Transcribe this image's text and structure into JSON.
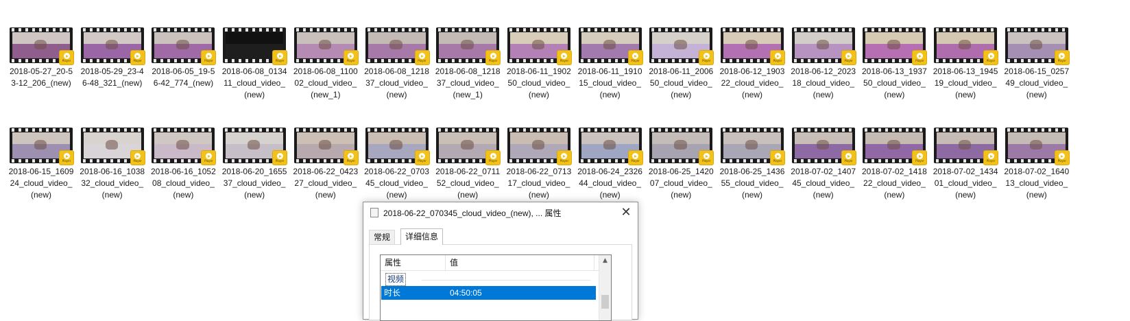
{
  "files": [
    {
      "name": "2018-05-27_20-53-12_206_(new)",
      "wall": "#cfc6c3",
      "bed": "#8f5e8d",
      "dark": false
    },
    {
      "name": "2018-05-29_23-46-48_321_(new)",
      "wall": "#d2c9c6",
      "bed": "#9a66a6",
      "dark": false
    },
    {
      "name": "2018-06-05_19-56-42_774_(new)",
      "wall": "#cbc1bd",
      "bed": "#a06aa7",
      "dark": false
    },
    {
      "name": "2018-06-08_013411_cloud_video_(new)",
      "wall": "#111111",
      "bed": "#1e1e1e",
      "dark": true
    },
    {
      "name": "2018-06-08_110002_cloud_video_(new_1)",
      "wall": "#c9c0bc",
      "bed": "#b58bb4",
      "dark": false
    },
    {
      "name": "2018-06-08_121837_cloud_video_(new)",
      "wall": "#c3bab6",
      "bed": "#a779a9",
      "dark": false
    },
    {
      "name": "2018-06-08_121837_cloud_video_(new_1)",
      "wall": "#c3bab6",
      "bed": "#a779a9",
      "dark": false
    },
    {
      "name": "2018-06-11_190250_cloud_video_(new)",
      "wall": "#d8cdb9",
      "bed": "#b481b6",
      "dark": false
    },
    {
      "name": "2018-06-11_191015_cloud_video_(new)",
      "wall": "#d5ccbd",
      "bed": "#a37aae",
      "dark": false
    },
    {
      "name": "2018-06-11_200650_cloud_video_(new)",
      "wall": "#d6d0cb",
      "bed": "#c4b3d6",
      "dark": false
    },
    {
      "name": "2018-06-12_190322_cloud_video_(new)",
      "wall": "#d8cbb8",
      "bed": "#b371b3",
      "dark": false
    },
    {
      "name": "2018-06-12_202318_cloud_video_(new)",
      "wall": "#d3cdc9",
      "bed": "#b793c2",
      "dark": false
    },
    {
      "name": "2018-06-13_193750_cloud_video_(new)",
      "wall": "#d6cab3",
      "bed": "#b66fb2",
      "dark": false
    },
    {
      "name": "2018-06-13_194519_cloud_video_(new)",
      "wall": "#d4c8b2",
      "bed": "#b06dae",
      "dark": false
    },
    {
      "name": "2018-06-15_025749_cloud_video_(new)",
      "wall": "#c9c2c0",
      "bed": "#a58fb3",
      "dark": false
    },
    {
      "name": "2018-06-15_160924_cloud_video_(new)",
      "wall": "#cdc4be",
      "bed": "#9c8fb0",
      "dark": false
    },
    {
      "name": "2018-06-16_103832_cloud_video_(new)",
      "wall": "#d9d3cf",
      "bed": "#d8d4d8",
      "dark": false
    },
    {
      "name": "2018-06-16_105208_cloud_video_(new)",
      "wall": "#cfc7c1",
      "bed": "#c9b9c9",
      "dark": false
    },
    {
      "name": "2018-06-20_165537_cloud_video_(new)",
      "wall": "#d6d2cf",
      "bed": "#c7bfc8",
      "dark": false
    },
    {
      "name": "2018-06-22_042327_cloud_video_(new)",
      "wall": "#cbbfb6",
      "bed": "#b7a9ad",
      "dark": false
    },
    {
      "name": "2018-06-22_070345_cloud_video_(new)",
      "wall": "#c9bdb4",
      "bed": "#a7a7c0",
      "dark": false
    },
    {
      "name": "2018-06-22_071152_cloud_video_(new)",
      "wall": "#cabfb6",
      "bed": "#b3a9b3",
      "dark": false
    },
    {
      "name": "2018-06-22_071317_cloud_video_(new)",
      "wall": "#c8bcb3",
      "bed": "#aea8b8",
      "dark": false
    },
    {
      "name": "2018-06-24_232644_cloud_video_(new)",
      "wall": "#c9c2bd",
      "bed": "#9ea6c4",
      "dark": false
    },
    {
      "name": "2018-06-25_142007_cloud_video_(new)",
      "wall": "#c4bcb8",
      "bed": "#a7a3b1",
      "dark": false
    },
    {
      "name": "2018-06-25_143655_cloud_video_(new)",
      "wall": "#c7c0bd",
      "bed": "#a9a6b6",
      "dark": false
    },
    {
      "name": "2018-07-02_140745_cloud_video_(new)",
      "wall": "#c8beb7",
      "bed": "#8d6aa4",
      "dark": false
    },
    {
      "name": "2018-07-02_141822_cloud_video_(new)",
      "wall": "#c6bbb3",
      "bed": "#9168a6",
      "dark": false
    },
    {
      "name": "2018-07-02_143401_cloud_video_(new)",
      "wall": "#c7bcb5",
      "bed": "#8e6aa3",
      "dark": false
    },
    {
      "name": "2018-07-02_164013_cloud_video_(new)",
      "wall": "#c5bbb5",
      "bed": "#9b7aa8",
      "dark": false
    }
  ],
  "badge_text": "Player",
  "dialog": {
    "title": "2018-06-22_070345_cloud_video_(new), ... 属性",
    "close": "✕",
    "tabs": [
      "常规",
      "详细信息"
    ],
    "active_tab": 1,
    "columns": [
      "属性",
      "值"
    ],
    "group": "视频",
    "selected_row": {
      "property": "时长",
      "value": "04:50:05"
    },
    "accent": "#0078d7"
  }
}
